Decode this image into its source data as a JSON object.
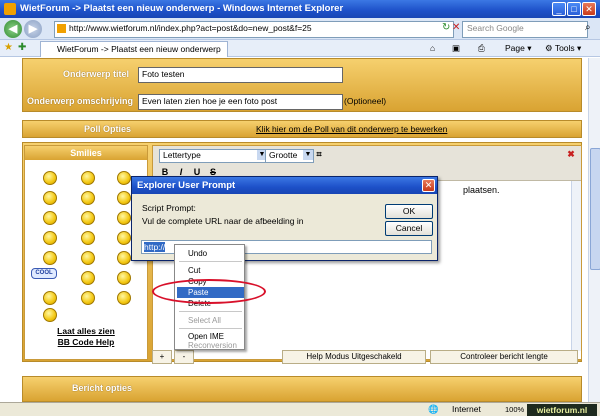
{
  "window": {
    "title": "WietForum -> Plaatst een nieuw onderwerp - Windows Internet Explorer"
  },
  "address_bar": {
    "url": "http://www.wietforum.nl/index.php?act=post&do=new_post&f=25"
  },
  "search": {
    "placeholder": "Search Google"
  },
  "tab": {
    "label": "WietForum -> Plaatst een nieuw onderwerp"
  },
  "toolbar": {
    "page_label": "Page",
    "tools_label": "Tools"
  },
  "form": {
    "topic_title_label": "Onderwerp titel",
    "topic_title_value": "Foto testen",
    "topic_desc_label": "Onderwerp omschrijving",
    "topic_desc_value": "Even laten zien hoe je een foto post",
    "optional_label": "(Optioneel)",
    "poll_label": "Poll Opties",
    "poll_link": "Klik hier om de Poll van dit onderwerp te bewerken",
    "smilies_header": "Smilies",
    "show_all_link": "Laat alles zien",
    "bbcode_help_link": "BB Code Help",
    "font_select": "Lettertype",
    "size_select": "Grootte",
    "editor_text_fragment": "plaatsen.",
    "help_mode_label": "Help Modus Uitgeschakeld",
    "check_length_label": "Controleer bericht lengte",
    "plus_label": "+",
    "minus_label": "-",
    "message_options_label": "Bericht opties"
  },
  "dialog": {
    "title": "Explorer User Prompt",
    "script_prompt": "Script Prompt:",
    "message": "Vul de complete URL naar de afbeelding in",
    "ok_label": "OK",
    "cancel_label": "Cancel",
    "input_value": "http://"
  },
  "context_menu": {
    "items": [
      "Undo",
      "Cut",
      "Copy",
      "Paste",
      "Delete",
      "Select All",
      "Open IME",
      "Reconversion"
    ],
    "highlighted": "Paste"
  },
  "status_bar": {
    "zone": "Internet",
    "zoom": "100%",
    "logo": "wietforum.nl"
  }
}
